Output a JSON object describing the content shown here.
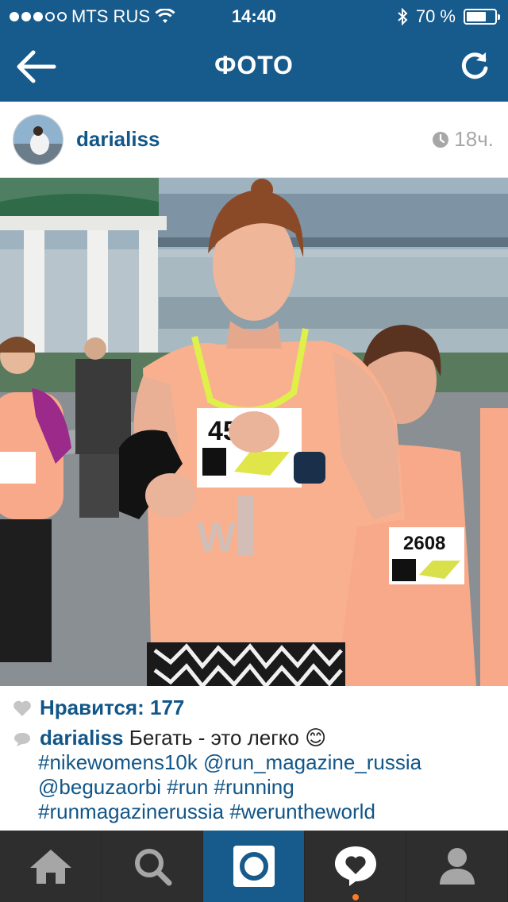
{
  "status_bar": {
    "carrier": "MTS RUS",
    "time": "14:40",
    "battery_percent": "70 %",
    "battery_level": 0.7
  },
  "nav": {
    "title": "ФОТО",
    "back_icon": "back-arrow-icon",
    "refresh_icon": "refresh-icon"
  },
  "post": {
    "username": "darialiss",
    "time_ago": "18ч.",
    "likes_label": "Нравится: 177",
    "caption_user": "darialiss",
    "caption_text": "Бегать - это легко",
    "caption_emoji": "😊",
    "hashtags_line1": "#nikewomens10k @run_magazine_russia",
    "hashtags_line2": "@beguzaorbi #run #running",
    "hashtags_line3": "#runmagazinerussia  #werunthe­world",
    "bib_number_main": "45",
    "bib_number_right": "2608"
  },
  "tabs": [
    {
      "icon": "home-icon",
      "active": false
    },
    {
      "icon": "search-icon",
      "active": false
    },
    {
      "icon": "camera-icon",
      "active": true
    },
    {
      "icon": "activity-heart-icon",
      "active": false
    },
    {
      "icon": "profile-icon",
      "active": false
    }
  ],
  "colors": {
    "brand_blue": "#175a8c",
    "link_blue": "#125688",
    "tab_bar": "#2e2e2e",
    "notification": "#f97d2a"
  }
}
